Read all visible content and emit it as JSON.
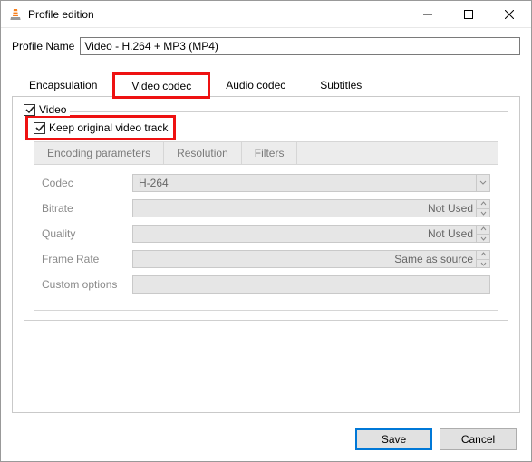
{
  "window": {
    "title": "Profile edition"
  },
  "profile": {
    "label": "Profile Name",
    "value": "Video - H.264 + MP3 (MP4)"
  },
  "tabs": {
    "encapsulation": "Encapsulation",
    "video": "Video codec",
    "audio": "Audio codec",
    "subtitles": "Subtitles"
  },
  "videoTab": {
    "videoCheck": "Video",
    "keepOriginal": "Keep original video track",
    "subtabs": {
      "encoding": "Encoding parameters",
      "resolution": "Resolution",
      "filters": "Filters"
    },
    "params": {
      "codec": {
        "label": "Codec",
        "value": "H-264"
      },
      "bitrate": {
        "label": "Bitrate",
        "value": "Not Used"
      },
      "quality": {
        "label": "Quality",
        "value": "Not Used"
      },
      "framerate": {
        "label": "Frame Rate",
        "value": "Same as source"
      },
      "custom": {
        "label": "Custom options",
        "value": ""
      }
    }
  },
  "footer": {
    "save": "Save",
    "cancel": "Cancel"
  }
}
